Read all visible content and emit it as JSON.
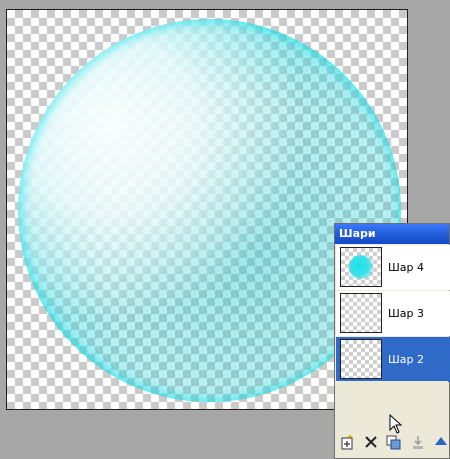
{
  "layers_panel": {
    "title": "Шари",
    "layers": [
      {
        "name": "Шар 4",
        "selected": false,
        "has_content": true
      },
      {
        "name": "Шар 3",
        "selected": false,
        "has_content": false
      },
      {
        "name": "Шар 2",
        "selected": true,
        "has_content": false
      }
    ],
    "toolbar": [
      {
        "icon": "new-layer-icon"
      },
      {
        "icon": "delete-icon"
      },
      {
        "icon": "duplicate-icon"
      },
      {
        "icon": "merge-down-icon"
      },
      {
        "icon": "move-up-icon"
      }
    ]
  },
  "colors": {
    "titlebar": "#2563dc",
    "selected_layer": "#2f6ac8",
    "panel_bg": "#ece9d8",
    "workspace_bg": "#a7a7a7",
    "bubble_cyan": "#18e3ea"
  }
}
